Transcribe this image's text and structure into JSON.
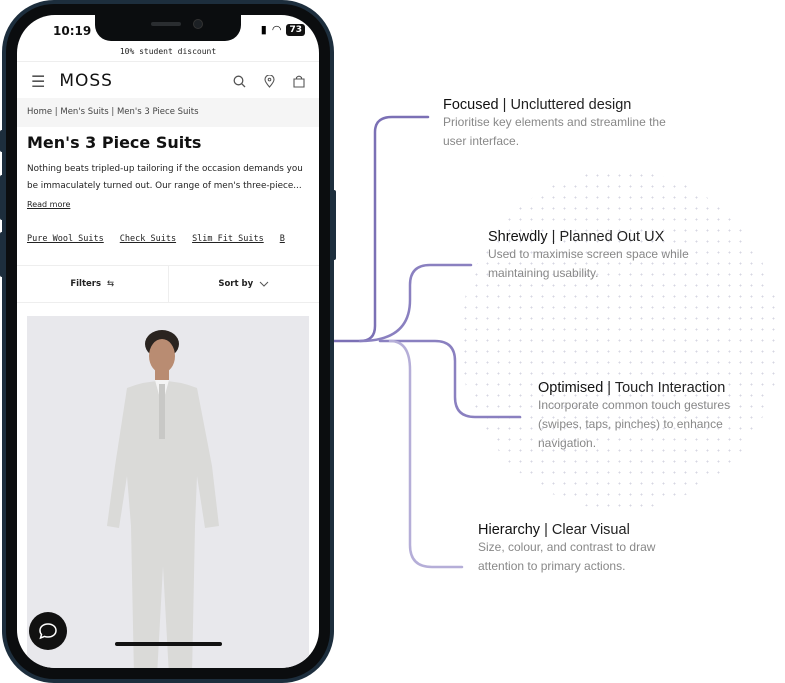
{
  "status_bar": {
    "time": "10:19",
    "battery": "73"
  },
  "promo": "10% student discount",
  "header": {
    "logo": "MOSS"
  },
  "breadcrumb": "Home | Men's Suits | Men's 3 Piece Suits",
  "page_title": "Men's 3 Piece Suits",
  "description": "Nothing beats tripled-up tailoring if the occasion demands you be immaculately turned out. Our range of men's three-piece...",
  "read_more": "Read more",
  "categories": [
    "Pure Wool Suits",
    "Check Suits",
    "Slim Fit Suits",
    "B"
  ],
  "toolbar": {
    "filters": "Filters",
    "sort": "Sort by"
  },
  "colors": {
    "accent": "#7b70b5",
    "frame": "#1d2e3d"
  },
  "features": [
    {
      "title": "Focused",
      "subtitle": "Uncluttered design",
      "text": "Prioritise key elements and streamline the user interface."
    },
    {
      "title": "Shrewdly",
      "subtitle": "Planned Out UX",
      "text": "Used to maximise screen space while maintaining usability."
    },
    {
      "title": "Optimised",
      "subtitle": "Touch Interaction",
      "text": "Incorporate common touch gestures (swipes, taps, pinches) to enhance navigation."
    },
    {
      "title": "Hierarchy",
      "subtitle": "Clear Visual",
      "text": "Size, colour, and contrast to draw attention to primary actions."
    }
  ]
}
